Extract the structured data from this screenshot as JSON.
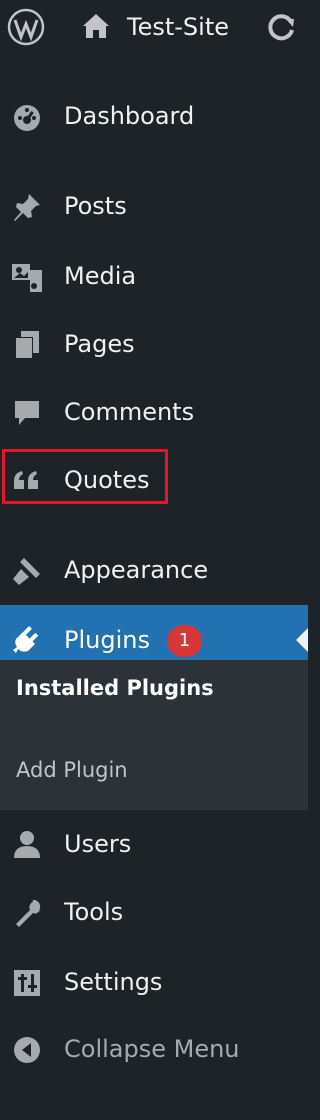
{
  "admin_bar": {
    "site_name": "Test-Site",
    "icons": [
      "wordpress-logo-icon",
      "home-icon",
      "refresh-icon"
    ]
  },
  "menu": {
    "dashboard": "Dashboard",
    "posts": "Posts",
    "media": "Media",
    "pages": "Pages",
    "comments": "Comments",
    "quotes": "Quotes",
    "appearance": "Appearance",
    "plugins": "Plugins",
    "plugins_badge": "1",
    "users": "Users",
    "tools": "Tools",
    "settings": "Settings",
    "collapse": "Collapse Menu"
  },
  "plugins_submenu": {
    "installed": "Installed Plugins",
    "add": "Add Plugin"
  },
  "colors": {
    "menu_bg": "#1d2327",
    "active_bg": "#2271b1",
    "submenu_bg": "#2c3338",
    "badge": "#d63638",
    "highlight_border": "#e3172b"
  }
}
